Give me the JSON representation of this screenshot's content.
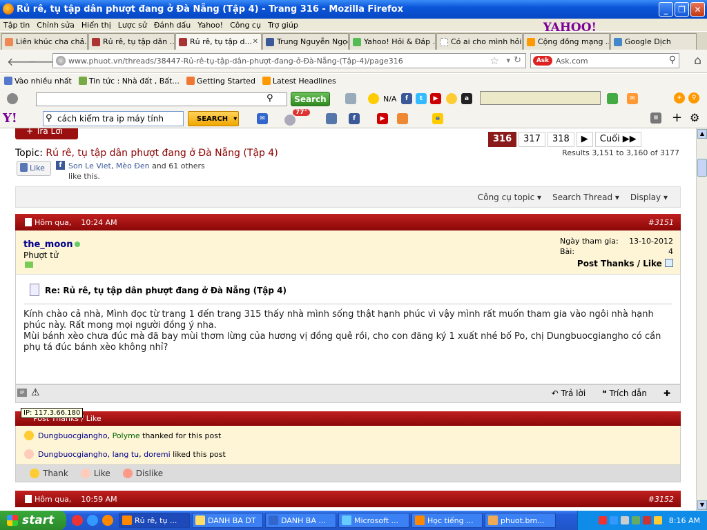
{
  "window": {
    "title": "Rủ rê, tụ tập dân phượt đang ở Đà Nẵng (Tập 4) - Trang 316 - Mozilla Firefox"
  },
  "menu": [
    "Tập tin",
    "Chỉnh sửa",
    "Hiển thị",
    "Lược sử",
    "Đánh dấu",
    "Yahoo!",
    "Công cụ",
    "Trợ giúp"
  ],
  "yahoo_brand": "YAHOO!",
  "tabs": [
    {
      "label": "Liên khúc cha chả..."
    },
    {
      "label": "Rủ rê, tụ tập dân ..."
    },
    {
      "label": "Rủ rê, tụ tập d..."
    },
    {
      "label": "Trung Nguyễn Ngọc"
    },
    {
      "label": "Yahoo! Hỏi & Đáp ..."
    },
    {
      "label": "Có ai cho mình hỏi..."
    },
    {
      "label": "Cộng đồng mạng ..."
    },
    {
      "label": "Google Dịch"
    }
  ],
  "nav": {
    "url": "www.phuot.vn/threads/38447-Rủ-rê-tụ-tập-dân-phượt-đang-ở-Đà-Nẵng-(Tập-4)/page316",
    "ask_placeholder": "Ask.com"
  },
  "bookmarks": [
    "Vào nhiều nhất",
    "Tin tức : Nhà đất , Bất...",
    "Getting Started",
    "Latest Headlines"
  ],
  "toolbar1": {
    "search_button": "Search",
    "na": "N/A"
  },
  "toolbar2": {
    "brand": "Y!",
    "search_value": "cách kiểm tra ip máy tính",
    "search_button": "SEARCH",
    "temperature": "77°"
  },
  "page": {
    "reply_button": "+ Trả Lời",
    "pager": [
      "316",
      "317",
      "318",
      "▶",
      "Cuối ▶▶"
    ],
    "results": "Results 3,151 to 3,160 of 3177",
    "topic_label": "Topic:",
    "topic_title": "Rủ rê, tụ tập dân phượt đang ở Đà Nẵng (Tập 4)",
    "like_button": "Like",
    "fb_names": [
      "Son Le Viet",
      "Mèo Đen"
    ],
    "fb_others": "and 61 others",
    "fb_tail": "like this.",
    "tools": [
      "Công cụ topic ▾",
      "Search Thread ▾",
      "Display ▾"
    ]
  },
  "post": {
    "date": "Hôm qua,",
    "time": "10:24 AM",
    "number": "#3151",
    "username": "the_moon",
    "rank": "Phượt tử",
    "join_label": "Ngày tham gia:",
    "join_date": "13-10-2012",
    "posts_label": "Bài:",
    "posts": "4",
    "post_thanks": "Post Thanks / Like",
    "title": "Re: Rủ rê, tụ tập dân phượt đang ở Đà Nẵng (Tập 4)",
    "body1": "Kính chào cả nhà, Mình đọc từ trang 1 đến trang 315 thấy nhà mình sống thật hạnh phúc vì vậy mình rất muốn tham gia vào ngôi nhà hạnh phúc này. Rất mong mọi người đồng ý nha.",
    "body2": "Mùi bánh xèo chưa đúc mà đã bay mùi thơm lừng của hương vị đồng quê rồi, cho con đăng ký 1 xuất nhé bố Po, chị Dungbuocgiangho có cần phụ tá đúc bánh xèo không nhỉ?",
    "reply": "Trả lời",
    "quote": "Trích dẫn",
    "ip_tooltip": "IP: 117.3.66.180"
  },
  "thanks": {
    "header": "Post Thanks / Like",
    "thanked_users": [
      "Dungbuocgiangho",
      "Polyme"
    ],
    "thanked_text": "thanked for this post",
    "liked_users": [
      "Dungbuocgiangho",
      "lang tu",
      "doremi"
    ],
    "liked_text": "liked this post",
    "buttons": [
      "Thank",
      "Like",
      "Dislike"
    ]
  },
  "next_post": {
    "date": "Hôm qua,",
    "time": "10:59 AM",
    "number": "#3152"
  },
  "taskbar": {
    "start": "start",
    "tasks": [
      "Rủ rê, tụ ...",
      "DANH BA DT",
      "DANH BA ...",
      "Microsoft ...",
      "Học tiếng ...",
      "phuot.bm..."
    ],
    "clock": "8:16 AM"
  },
  "colors": {
    "accent_red": "#8b0808",
    "title_blue": "#0a55d8",
    "user_bg": "#fdf5d6"
  }
}
